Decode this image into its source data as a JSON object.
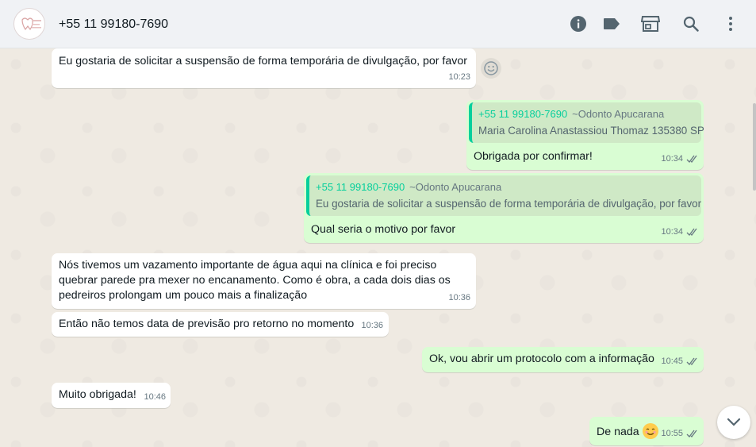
{
  "header": {
    "contact_name": "+55 11 99180-7690",
    "icons": [
      "info-icon",
      "label-icon",
      "catalog-icon",
      "search-icon",
      "menu-icon"
    ]
  },
  "messages": [
    {
      "dir": "in",
      "text": "Eu gostaria de solicitar a suspensão de forma temporária de divulgação, por favor",
      "time": "10:23"
    },
    {
      "dir": "out",
      "quote": {
        "phone": "+55 11 99180-7690",
        "group": "~Odonto Apucarana",
        "text": "Maria Carolina Anastassiou Thomaz 135380 SP"
      },
      "text": "Obrigada por confirmar!",
      "time": "10:34"
    },
    {
      "dir": "out",
      "quote": {
        "phone": "+55 11 99180-7690",
        "group": "~Odonto Apucarana",
        "text": "Eu gostaria de solicitar a suspensão de forma temporária de divulgação, por favor"
      },
      "text": "Qual seria o motivo por favor",
      "time": "10:34"
    },
    {
      "dir": "in",
      "text": "Nós tivemos um vazamento importante de água aqui na clínica e foi preciso quebrar parede pra mexer no encanamento. Como é obra, a cada dois dias os pedreiros prolongam um pouco mais a finalização",
      "time": "10:36"
    },
    {
      "dir": "in",
      "text": "Então não temos data de previsão pro retorno no momento",
      "time": "10:36"
    },
    {
      "dir": "out",
      "text": "Ok, vou abrir um protocolo com a informação",
      "time": "10:45"
    },
    {
      "dir": "in",
      "text": "Muito obrigada!",
      "time": "10:46"
    },
    {
      "dir": "out",
      "text": "De nada",
      "time": "10:55"
    }
  ],
  "colors": {
    "incoming_bubble": "#ffffff",
    "outgoing_bubble": "#d9fdd3",
    "quote_accent": "#06cf9c",
    "read_ticks": "#667781"
  }
}
